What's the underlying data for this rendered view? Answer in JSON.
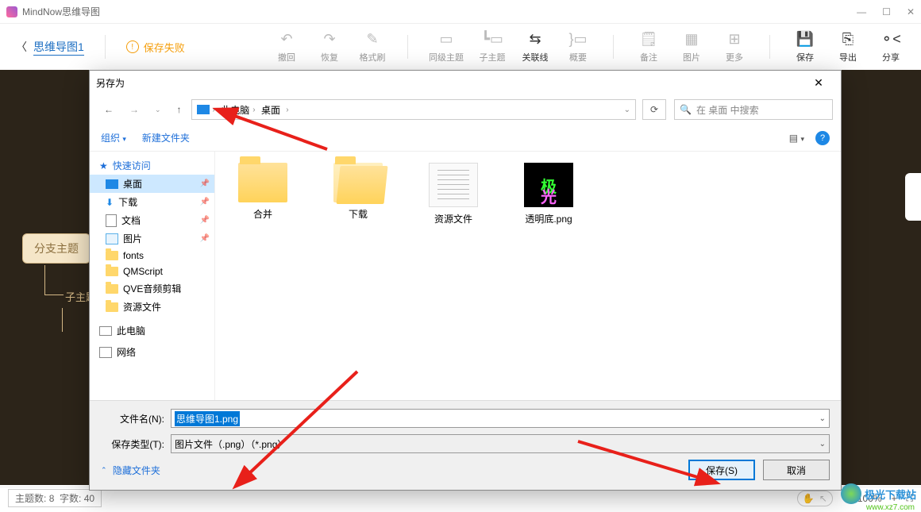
{
  "app": {
    "title": "MindNow思维导图"
  },
  "nav": {
    "back_label": "思维导图1"
  },
  "status": {
    "fail": "保存失败"
  },
  "toolbar": {
    "undo": "撤回",
    "redo": "恢复",
    "format": "格式刷",
    "peer": "同级主题",
    "child": "子主题",
    "relate": "关联线",
    "summary": "概要",
    "note": "备注",
    "image": "图片",
    "more": "更多",
    "save": "保存",
    "export": "导出",
    "share": "分享"
  },
  "mind": {
    "branch": "分支主题",
    "sub": "子主题"
  },
  "statusbar": {
    "topics_label": "主题数:",
    "topics": "8",
    "words_label": "字数:",
    "words": "40",
    "zoom": "100%"
  },
  "dialog": {
    "title": "另存为",
    "crumbs": [
      "此电脑",
      "桌面"
    ],
    "search_placeholder": "在 桌面 中搜索",
    "organize": "组织",
    "new_folder": "新建文件夹",
    "sidebar": {
      "quick": "快速访问",
      "items": [
        "桌面",
        "下载",
        "文档",
        "图片",
        "fonts",
        "QMScript",
        "QVE音频剪辑",
        "资源文件"
      ],
      "this_pc": "此电脑",
      "network": "网络"
    },
    "files": [
      {
        "name": "合并",
        "type": "folder"
      },
      {
        "name": "下载",
        "type": "folder-open"
      },
      {
        "name": "资源文件",
        "type": "docfolder"
      },
      {
        "name": "透明底.png",
        "type": "image"
      }
    ],
    "filename_label": "文件名(N):",
    "filename_value": "思维导图1.png",
    "type_label": "保存类型(T):",
    "type_value": "图片文件（.png）（*.png）",
    "hide": "隐藏文件夹",
    "save_btn": "保存(S)",
    "cancel_btn": "取消"
  },
  "watermark": {
    "text": "极光下载站",
    "url": "www.xz7.com"
  }
}
